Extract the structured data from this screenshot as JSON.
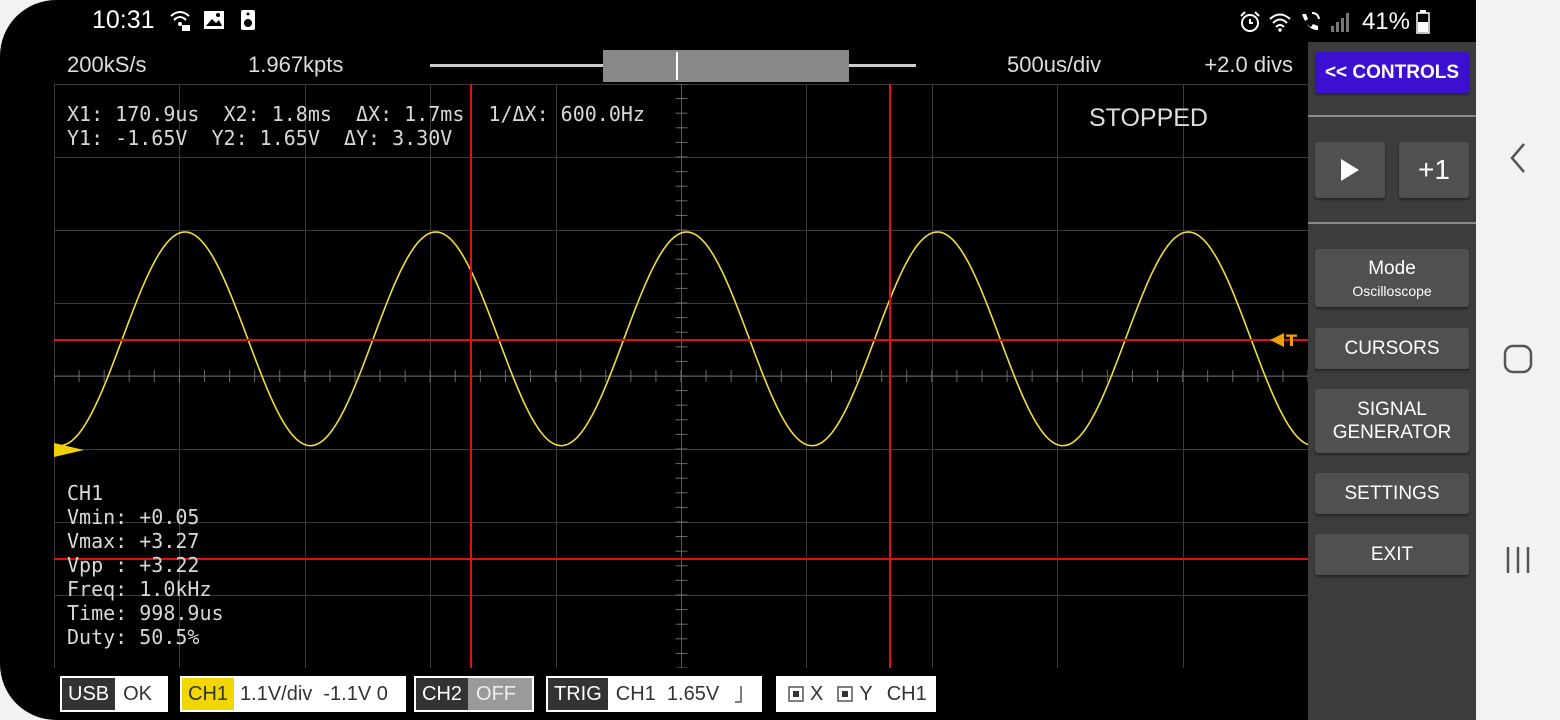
{
  "status_bar": {
    "time": "10:31",
    "left_icons": [
      "wifi-share-icon",
      "image-icon",
      "speaker-icon"
    ],
    "right_icons": [
      "alarm-icon",
      "wifi-icon",
      "wifi-call-icon",
      "signal-icon",
      "battery-icon"
    ],
    "battery": "41%"
  },
  "top_bar": {
    "sample_rate": "200kS/s",
    "points": "1.967kpts",
    "timebase": "500us/div",
    "offset": "+2.0 divs",
    "scroll_thumb_fraction": 0.5
  },
  "cursor_readout": {
    "line1": "X1: 170.9us  X2: 1.8ms  ΔX: 1.7ms  1/ΔX: 600.0Hz",
    "line2": "Y1: -1.65V  Y2: 1.65V  ΔY: 3.30V"
  },
  "state": "STOPPED",
  "measurements": {
    "channel": "CH1",
    "vmin": "Vmin: +0.05",
    "vmax": "Vmax: +3.27",
    "vpp": "Vpp : +3.22",
    "freq": "Freq: 1.0kHz",
    "time": "Time: 998.9us",
    "duty": "Duty: 50.5%"
  },
  "bottom_bar": {
    "usb_label": "USB",
    "usb_value": "OK",
    "ch1_label": "CH1",
    "ch1_value": "1.1V/div  -1.1V 0",
    "ch2_label": "CH2",
    "ch2_value": "OFF",
    "trig_label": "TRIG",
    "trig_value": "CH1  1.65V",
    "x_label": "X",
    "y_label": "Y",
    "xy_channel": "CH1"
  },
  "controls": {
    "toggle_label": "<< CONTROLS",
    "plus_one": "+1",
    "mode_label": "Mode",
    "mode_value": "Oscilloscope",
    "cursors": "CURSORS",
    "signal_generator_1": "SIGNAL",
    "signal_generator_2": "GENERATOR",
    "settings": "SETTINGS",
    "exit": "EXIT"
  },
  "colors": {
    "trace": "#f2dc3c",
    "cursor": "#e01010",
    "accent": "#3b10d0",
    "panel": "#3c3c3c",
    "button": "#505050"
  },
  "chart_data": {
    "type": "line",
    "series": [
      {
        "name": "CH1",
        "frequency_hz": 1000,
        "vmin": 0.05,
        "vmax": 3.27
      }
    ],
    "timebase_per_div": "500us/div",
    "cursors": {
      "x1": "170.9us",
      "x2": "1.8ms",
      "y1": "-1.65V",
      "y2": "1.65V"
    }
  }
}
